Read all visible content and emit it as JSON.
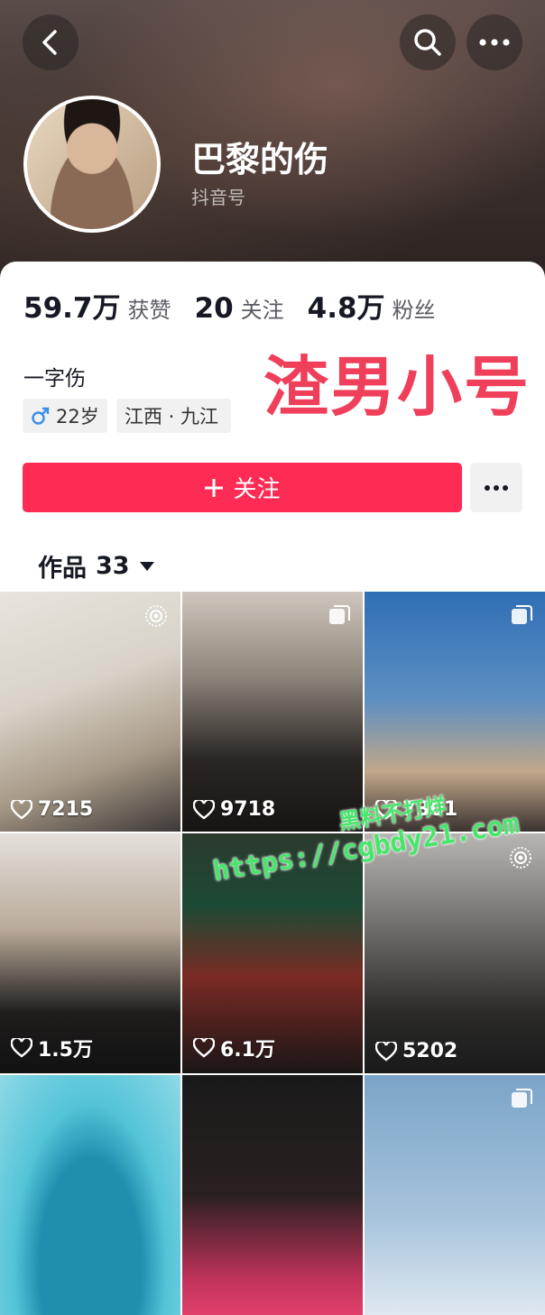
{
  "profile": {
    "name": "巴黎的伤",
    "douyin_id_label": "抖音号",
    "bio": "一字伤",
    "gender_icon": "male-icon",
    "age": "22岁",
    "location": "江西 · 九江",
    "overlay_caption": "渣男小号"
  },
  "stats": [
    {
      "value": "59.7万",
      "label": "获赞"
    },
    {
      "value": "20",
      "label": "关注"
    },
    {
      "value": "4.8万",
      "label": "粉丝"
    }
  ],
  "actions": {
    "follow_label": "关注"
  },
  "works": {
    "label": "作品",
    "count": "33"
  },
  "videos": [
    {
      "likes": "7215",
      "badge": "live-photo-icon"
    },
    {
      "likes": "9718",
      "badge": "album-icon"
    },
    {
      "likes": "7301",
      "badge": "album-icon"
    },
    {
      "likes": "1.5万",
      "badge": ""
    },
    {
      "likes": "6.1万",
      "badge": ""
    },
    {
      "likes": "5202",
      "badge": "live-photo-icon"
    },
    {
      "likes": "",
      "badge": ""
    },
    {
      "likes": "",
      "badge": ""
    },
    {
      "likes": "",
      "badge": "album-icon"
    }
  ],
  "watermark": {
    "line1": "黑料不打烊",
    "line2": "https://cgbdy21.com"
  },
  "colors": {
    "accent": "#fe2c55",
    "overlay_text": "#ef3f5a",
    "watermark": "#47e66a"
  }
}
